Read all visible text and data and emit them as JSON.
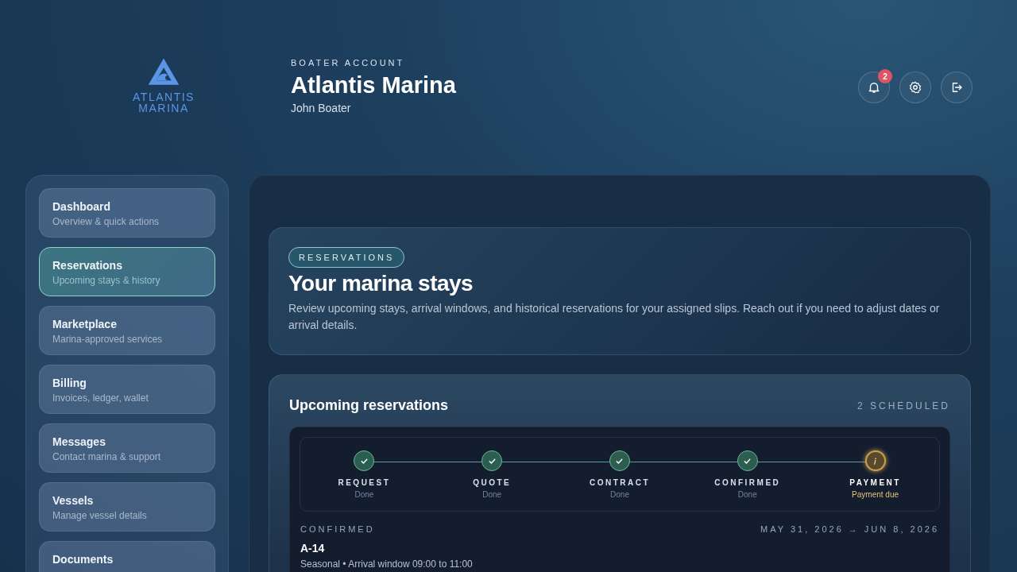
{
  "logo": {
    "line1": "ATLANTIS",
    "line2": "MARINA"
  },
  "header": {
    "eyebrow": "BOATER ACCOUNT",
    "title": "Atlantis Marina",
    "user": "John Boater"
  },
  "actions": [
    {
      "kind": "notifications",
      "badge": "2"
    },
    {
      "kind": "settings"
    },
    {
      "kind": "logout"
    }
  ],
  "sidebar": {
    "items": [
      {
        "label": "Dashboard",
        "description": "Overview & quick actions",
        "selected": false
      },
      {
        "label": "Reservations",
        "description": "Upcoming stays & history",
        "selected": true
      },
      {
        "label": "Marketplace",
        "description": "Marina-approved services",
        "selected": false
      },
      {
        "label": "Billing",
        "description": "Invoices, ledger, wallet",
        "selected": false
      },
      {
        "label": "Messages",
        "description": "Contact marina & support",
        "selected": false
      },
      {
        "label": "Vessels",
        "description": "Manage vessel details",
        "selected": false
      },
      {
        "label": "Documents",
        "selected": false
      }
    ]
  },
  "hero": {
    "tag": "RESERVATIONS",
    "title": "Your marina stays",
    "text": "Review upcoming stays, arrival windows, and historical reservations for your assigned slips. Reach out if you need to adjust dates or arrival details."
  },
  "upcoming": {
    "title": "Upcoming reservations",
    "count": "2 SCHEDULED",
    "reservations": [
      {
        "steps": [
          {
            "label": "REQUEST",
            "status": "Done",
            "kind": "done"
          },
          {
            "label": "QUOTE",
            "status": "Done",
            "kind": "done"
          },
          {
            "label": "CONTRACT",
            "status": "Done",
            "kind": "done"
          },
          {
            "label": "CONFIRMED",
            "status": "Done",
            "kind": "done"
          },
          {
            "label": "PAYMENT",
            "status": "Payment due",
            "kind": "current"
          }
        ],
        "stage": "CONFIRMED",
        "dates": "MAY 31, 2026 → JUN 8, 2026",
        "slip": "A-14",
        "details": "Seasonal • Arrival window 09:00 to 11:00"
      }
    ]
  }
}
